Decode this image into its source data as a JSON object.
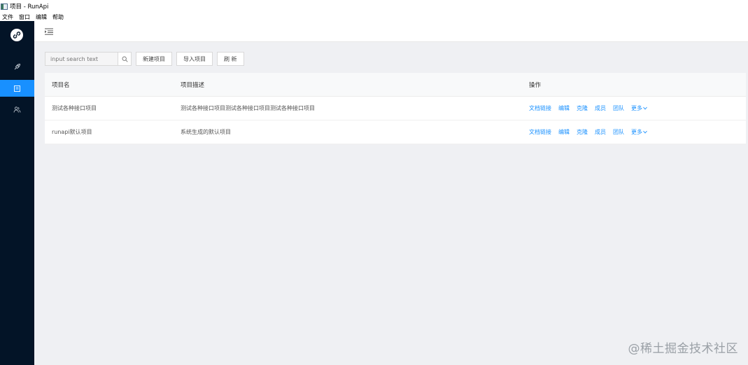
{
  "window": {
    "title": "项目 - RunApi"
  },
  "menubar": {
    "items": [
      "文件",
      "窗口",
      "编辑",
      "帮助"
    ]
  },
  "sidebar": {
    "logo": "link-icon",
    "items": [
      {
        "icon": "rocket-icon",
        "active": false
      },
      {
        "icon": "project-icon",
        "active": true
      },
      {
        "icon": "team-icon",
        "active": false
      }
    ]
  },
  "toolbar": {
    "search_placeholder": "input search text",
    "new_project": "新建项目",
    "import_project": "导入项目",
    "refresh": "刷 新"
  },
  "table": {
    "headers": [
      "项目名",
      "项目描述",
      "操作"
    ],
    "rows": [
      {
        "name": "测试各种接口项目",
        "desc": "测试各种接口项目测试各种接口项目测试各种接口项目"
      },
      {
        "name": "runapi默认项目",
        "desc": "系统生成的默认项目"
      }
    ],
    "actions": [
      "文档链接",
      "编辑",
      "克隆",
      "成员",
      "团队"
    ],
    "more": "更多"
  },
  "watermark": "@稀土掘金技术社区",
  "colors": {
    "sidebar_bg": "#031427",
    "accent": "#1890ff",
    "content_bg": "#eff0f3"
  }
}
